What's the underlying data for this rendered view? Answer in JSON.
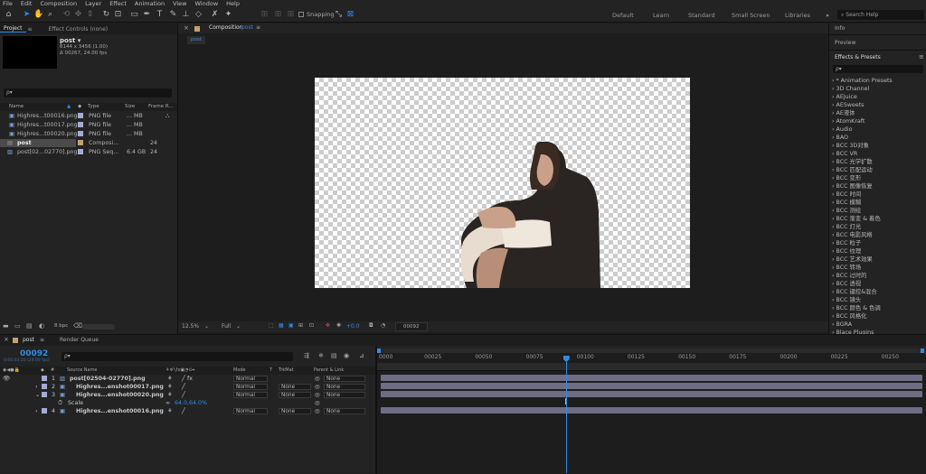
{
  "menu": [
    "File",
    "Edit",
    "Composition",
    "Layer",
    "Effect",
    "Animation",
    "View",
    "Window",
    "Help"
  ],
  "toolbar": {
    "snapping_label": "Snapping"
  },
  "workspaces": [
    "Default",
    "Learn",
    "Standard",
    "Small Screen",
    "Libraries"
  ],
  "search_help_placeholder": "Search Help",
  "project_panel": {
    "tab_project": "Project",
    "tab_effect_controls": "Effect Controls (none)",
    "selected_name": "post ▾",
    "selected_info_1": "6144 x 3456 (1.00)",
    "selected_info_2": "Δ 00267, 24.00 fps",
    "search_placeholder": "ρ▾",
    "columns": {
      "name": "Name",
      "type": "Type",
      "size": "Size",
      "frame_rate": "Frame R..."
    },
    "items": [
      {
        "name": "Highres...t00016.png",
        "type": "PNG file",
        "size": "... MB",
        "fps": ""
      },
      {
        "name": "Highres...t00017.png",
        "type": "PNG file",
        "size": "... MB",
        "fps": ""
      },
      {
        "name": "Highres...t00020.png",
        "type": "PNG file",
        "size": "... MB",
        "fps": ""
      },
      {
        "name": "post",
        "type": "Composi...",
        "size": "",
        "fps": "24"
      },
      {
        "name": "post[02...02770].png",
        "type": "PNG Seq...",
        "size": "6.4 GB",
        "fps": "24"
      }
    ],
    "bpc": "8 bpc"
  },
  "composition_panel": {
    "tab_label": "Composition",
    "tab_comp_name": "post",
    "breadcrumb": "post",
    "zoom": "12.5%",
    "resolution": "Full",
    "exposure": "+0.0",
    "timecode": "00092"
  },
  "right_panel": {
    "info": "Info",
    "preview": "Preview",
    "effects_title": "Effects & Presets",
    "search_placeholder": "ρ▾",
    "effects": [
      "* Animation Presets",
      "3D Channel",
      "AEJuice",
      "AESweets",
      "AE液体",
      "AtomKraft",
      "Audio",
      "BAO",
      "BCC 3D对象",
      "BCC VR",
      "BCC 光学扩散",
      "BCC 匹配运动",
      "BCC 变形",
      "BCC 图像恢复",
      "BCC 时间",
      "BCC 模糊",
      "BCC 测绘",
      "BCC 渐变 & 着色",
      "BCC 灯光",
      "BCC 电影风格",
      "BCC 粒子",
      "BCC 纹理",
      "BCC 艺术效果",
      "BCC 转场",
      "BCC 过时的",
      "BCC 透视",
      "BCC 键控&混合",
      "BCC 镜头",
      "BCC 颜色 & 色调",
      "BCC 风格化",
      "BGRA",
      "Blace Plugins"
    ]
  },
  "timeline": {
    "tab_comp": "post",
    "tab_render_queue": "Render Queue",
    "current_time": "00092",
    "time_detail": "0:00:03:20 (24.00 fps)",
    "search_placeholder": "ρ▾",
    "columns": {
      "source_name": "Source Name",
      "mode": "Mode",
      "t": "T",
      "trkmat": "TrkMat",
      "parent": "Parent & Link"
    },
    "layers": [
      {
        "num": "1",
        "name": "post[02504-02770].png",
        "mode": "Normal",
        "trkmat": "",
        "parent": "None"
      },
      {
        "num": "2",
        "name": "Highres...enshot00017.png",
        "mode": "Normal",
        "trkmat": "None",
        "parent": "None"
      },
      {
        "num": "3",
        "name": "Highres...enshot00020.png",
        "mode": "Normal",
        "trkmat": "None",
        "parent": "None"
      },
      {
        "num": "4",
        "name": "Highres...enshot00016.png",
        "mode": "Normal",
        "trkmat": "None",
        "parent": "None"
      }
    ],
    "scale_label": "Scale",
    "scale_value": "64.0,64.0%",
    "ruler": [
      "0000",
      "00025",
      "00050",
      "00075",
      "00100",
      "00125",
      "00150",
      "00175",
      "00200",
      "00225",
      "00250"
    ],
    "playhead_frame": 92,
    "total_frames": 267
  }
}
